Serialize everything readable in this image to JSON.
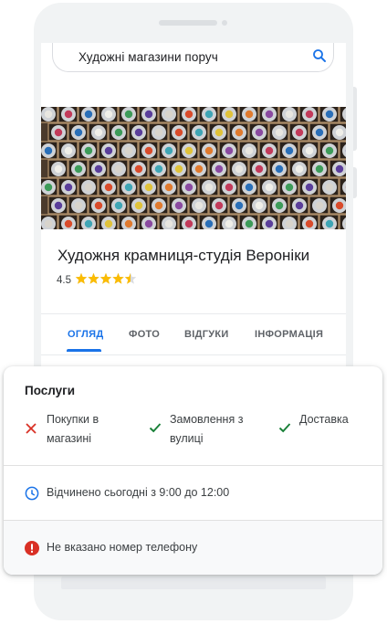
{
  "search": {
    "query": "Художні магазини поруч"
  },
  "business": {
    "name": "Художня крамниця-студія Вероніки",
    "rating": "4.5",
    "stars": 4.5
  },
  "tabs": [
    {
      "label": "ОГЛЯД",
      "active": true
    },
    {
      "label": "ФОТО",
      "active": false
    },
    {
      "label": "ВІДГУКИ",
      "active": false
    },
    {
      "label": "ІНФОРМАЦІЯ",
      "active": false
    }
  ],
  "services": {
    "title": "Послуги",
    "items": [
      {
        "line1": "Покупки в",
        "line2": "магазині",
        "available": false
      },
      {
        "line1": "Замовлення з",
        "line2": "вулиці",
        "available": true
      },
      {
        "line1": "Доставка",
        "line2": "",
        "available": true
      }
    ]
  },
  "hours": {
    "text": "Відчинено сьогодні з 9:00 до 12:00"
  },
  "phone_notice": {
    "text": "Не вказано номер телефону"
  },
  "colors": {
    "accent": "#1a73e8",
    "available": "#188038",
    "unavailable": "#d93025",
    "star": "#fbbc04"
  }
}
